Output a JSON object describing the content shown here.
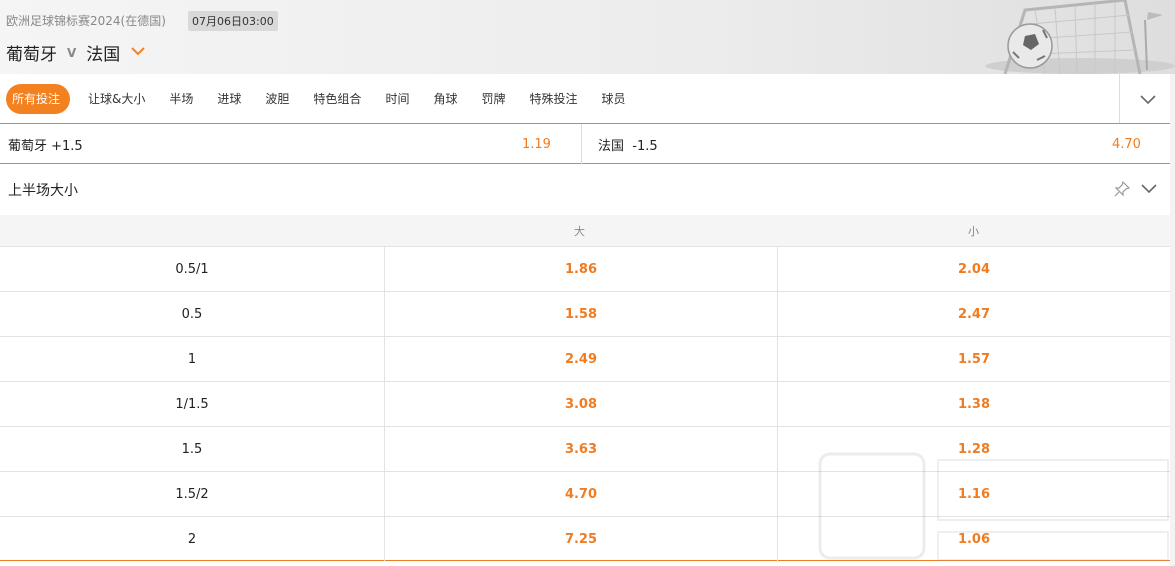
{
  "header": {
    "league": "欧洲足球锦标赛2024(在德国)",
    "kickoff": "07月06日03:00",
    "home_team": "葡萄牙",
    "vs": "V",
    "away_team": "法国"
  },
  "nav": {
    "tabs": [
      "所有投注",
      "让球&大小",
      "半场",
      "进球",
      "波胆",
      "特色组合",
      "时间",
      "角球",
      "罚牌",
      "特殊投注",
      "球员"
    ]
  },
  "handicap": {
    "left_team": "葡萄牙 +1.5",
    "left_odds": "1.19",
    "right_team": "法国  -1.5",
    "right_odds": "4.70"
  },
  "section": {
    "title": "上半场大小",
    "col_over": "大",
    "col_under": "小",
    "rows": [
      {
        "line": "0.5/1",
        "over": "1.86",
        "under": "2.04"
      },
      {
        "line": "0.5",
        "over": "1.58",
        "under": "2.47"
      },
      {
        "line": "1",
        "over": "2.49",
        "under": "1.57"
      },
      {
        "line": "1/1.5",
        "over": "3.08",
        "under": "1.38"
      },
      {
        "line": "1.5",
        "over": "3.63",
        "under": "1.28"
      },
      {
        "line": "1.5/2",
        "over": "4.70",
        "under": "1.16"
      },
      {
        "line": "2",
        "over": "7.25",
        "under": "1.06"
      }
    ]
  },
  "colors": {
    "accent": "#f48120",
    "odds": "#f07c22"
  },
  "icons": {
    "team_dropdown": "chevron-down-icon",
    "nav_expand": "chevron-down-icon",
    "pin": "pin-icon",
    "collapse": "chevron-down-icon"
  }
}
